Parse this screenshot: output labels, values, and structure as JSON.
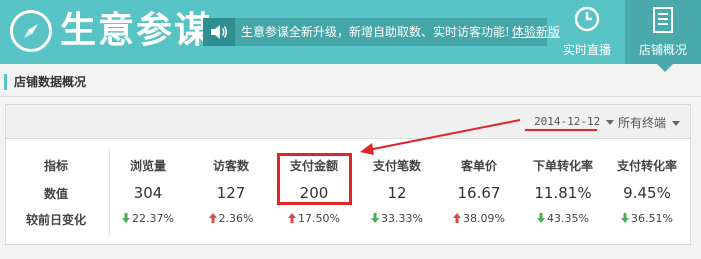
{
  "header": {
    "brand": "生意参谋",
    "notice_text": "生意参谋全新升级，新增自助取数、实时访客功能!",
    "notice_link": "体验新版",
    "nav": [
      {
        "label": "实时直播",
        "icon": "clock-icon"
      },
      {
        "label": "店铺概况",
        "icon": "document-icon"
      }
    ]
  },
  "section": {
    "title": "店铺数据概况"
  },
  "filters": {
    "date": "2014-12-12",
    "terminal": "所有终端"
  },
  "table": {
    "row_labels": [
      "指标",
      "数值",
      "较前日变化"
    ],
    "columns": [
      {
        "name": "浏览量",
        "value": "304",
        "change": "22.37%",
        "direction": "down"
      },
      {
        "name": "访客数",
        "value": "127",
        "change": "2.36%",
        "direction": "up"
      },
      {
        "name": "支付金额",
        "value": "200",
        "change": "17.50%",
        "direction": "up"
      },
      {
        "name": "支付笔数",
        "value": "12",
        "change": "33.33%",
        "direction": "down"
      },
      {
        "name": "客单价",
        "value": "16.67",
        "change": "38.09%",
        "direction": "up"
      },
      {
        "name": "下单转化率",
        "value": "11.81%",
        "change": "43.35%",
        "direction": "down"
      },
      {
        "name": "支付转化率",
        "value": "9.45%",
        "change": "36.51%",
        "direction": "down"
      }
    ]
  },
  "colors": {
    "header": "#58c3c4",
    "up": "#e0454a",
    "down": "#4eae4e",
    "annotation": "#e0262b"
  }
}
